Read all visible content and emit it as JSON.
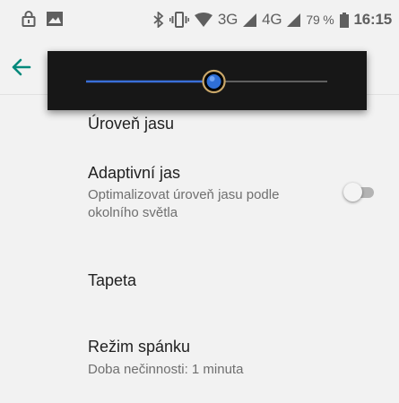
{
  "status_bar": {
    "icons": [
      "lock-icon",
      "image-notification-icon",
      "bluetooth-icon",
      "vibrate-icon",
      "wifi-icon",
      "signal-icon",
      "battery-icon"
    ],
    "network_3g": "3G",
    "network_4g": "4G",
    "battery": "79 %",
    "time": "16:15"
  },
  "brightness": {
    "level": 0.53,
    "accent": "#3a6fd8"
  },
  "settings": {
    "brightness_label": "Úroveň jasu",
    "adaptive": {
      "title": "Adaptivní jas",
      "summary": "Optimalizovat úroveň jasu podle okolního světla",
      "enabled": false
    },
    "wallpaper": {
      "title": "Tapeta"
    },
    "sleep": {
      "title": "Režim spánku",
      "summary": "Doba nečinnosti: 1 minuta"
    }
  },
  "colors": {
    "accent": "#00897b",
    "background": "#f2f2f2"
  }
}
